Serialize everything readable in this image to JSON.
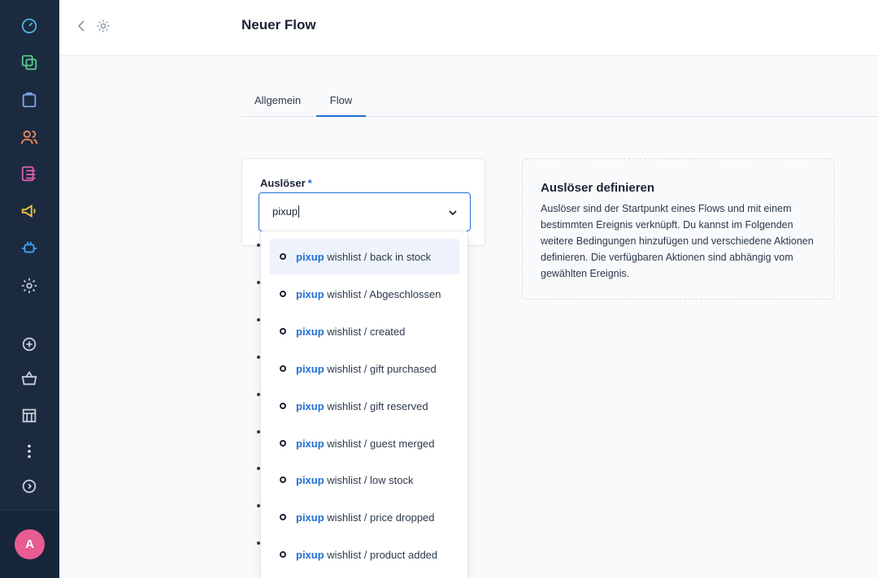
{
  "sidebar": {
    "icons": [
      {
        "name": "dashboard-icon",
        "color": "#4fb3d9"
      },
      {
        "name": "catalog-icon",
        "color": "#57c98a"
      },
      {
        "name": "orders-icon",
        "color": "#7fa7e8"
      },
      {
        "name": "customers-icon",
        "color": "#f08a5d"
      },
      {
        "name": "content-icon",
        "color": "#e05db0"
      },
      {
        "name": "marketing-icon",
        "color": "#f2c744"
      },
      {
        "name": "extensions-icon",
        "color": "#3ea3f2"
      },
      {
        "name": "settings-icon",
        "color": "#c5ccd6"
      },
      {
        "name": "add-icon",
        "color": "#c5ccd6"
      },
      {
        "name": "basket-icon",
        "color": "#c5ccd6"
      },
      {
        "name": "store-icon",
        "color": "#c5ccd6"
      },
      {
        "name": "more-icon",
        "color": "#c5ccd6"
      },
      {
        "name": "expand-icon",
        "color": "#c5ccd6"
      }
    ],
    "avatar_initial": "A",
    "avatar_color": "#e85c92"
  },
  "header": {
    "title": "Neuer Flow"
  },
  "tabs": [
    {
      "label": "Allgemein",
      "active": false
    },
    {
      "label": "Flow",
      "active": true
    }
  ],
  "trigger": {
    "label": "Auslöser",
    "required_mark": "*",
    "value": "pixup"
  },
  "dropdown": {
    "highlight": "pixup",
    "items": [
      {
        "suffix": " wishlist / back in stock"
      },
      {
        "suffix": " wishlist / Abgeschlossen"
      },
      {
        "suffix": " wishlist / created"
      },
      {
        "suffix": " wishlist / gift purchased"
      },
      {
        "suffix": " wishlist / gift reserved"
      },
      {
        "suffix": " wishlist / guest merged"
      },
      {
        "suffix": " wishlist / low stock"
      },
      {
        "suffix": " wishlist / price dropped"
      },
      {
        "suffix": " wishlist / product added"
      }
    ]
  },
  "help": {
    "title": "Auslöser definieren",
    "body": "Auslöser sind der Startpunkt eines Flows und mit einem bestimmten Ereignis verknüpft. Du kannst im Folgenden weitere Bedingungen hinzufügen und verschiedene Aktionen definieren. Die verfügbaren Aktionen sind abhängig vom gewählten Ereignis."
  },
  "accent_color": "#1f6fd1"
}
